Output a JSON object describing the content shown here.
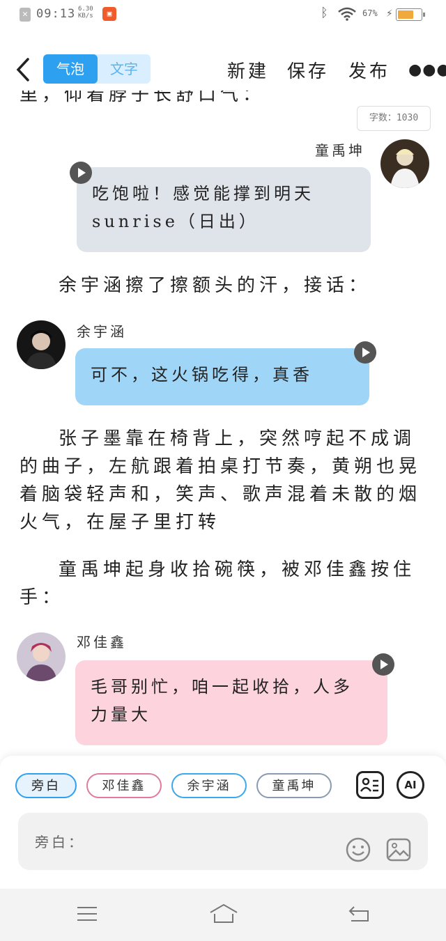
{
  "status_bar": {
    "time": "09:13",
    "speed": "6.30 KB/s",
    "battery": "67%"
  },
  "header": {
    "tabs": [
      "气泡",
      "文字"
    ],
    "actions": [
      "新建",
      "保存",
      "发布"
    ]
  },
  "word_count": "字数：1030",
  "cut_line": "里，仰着脖子长舒口气：",
  "messages": [
    {
      "speaker": "童禹坤",
      "text": "吃饱啦！感觉能撑到明天sunrise（日出）",
      "bubble_color": "#dfe3ea"
    },
    {
      "speaker": "余宇涵",
      "text": "可不，这火锅吃得，真香",
      "bubble_color": "#9fd6f8"
    },
    {
      "speaker": "邓佳鑫",
      "text": "毛哥别忙，咱一起收拾，人多力量大",
      "bubble_color": "#fdd3de"
    }
  ],
  "narration": [
    "余宇涵擦了擦额头的汗，接话：",
    "张子墨靠在椅背上，突然哼起不成调的曲子，左航跟着拍桌打节奏，黄朔也晃着脑袋轻声和，笑声、歌声混着未散的烟火气，在屋子里打转",
    "童禹坤起身收拾碗筷，被邓佳鑫按住手："
  ],
  "chips": [
    "旁白",
    "邓佳鑫",
    "余宇涵",
    "童禹坤"
  ],
  "ai_label": "AI",
  "input_placeholder": "旁白：",
  "colors": {
    "accent": "#2ea0f0",
    "chip_narration": "#2ea0f0",
    "chip_deng": "#e07b9a",
    "chip_yu": "#3aa8ea",
    "chip_tong": "#8a9ab0"
  }
}
